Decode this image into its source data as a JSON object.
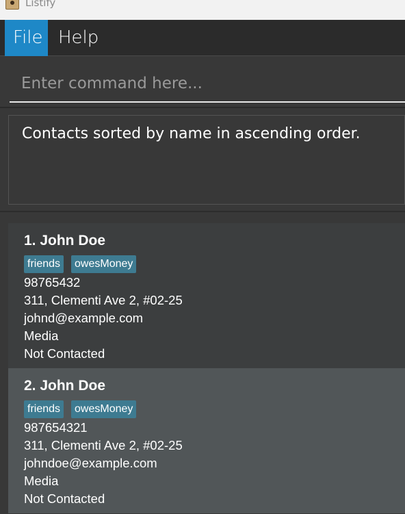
{
  "window": {
    "title": "Listify"
  },
  "menu": {
    "file_label": "File",
    "help_label": "Help"
  },
  "command": {
    "placeholder": "Enter command here..."
  },
  "result": {
    "message": "Contacts sorted by name in ascending order."
  },
  "contacts": [
    {
      "name": "1. John Doe",
      "tags": [
        "friends",
        "owesMoney"
      ],
      "phone": "98765432",
      "address": "311, Clementi Ave 2, #02-25",
      "email": "johnd@example.com",
      "media": "Media",
      "status": "Not Contacted"
    },
    {
      "name": "2. John Doe",
      "tags": [
        "friends",
        "owesMoney"
      ],
      "phone": "987654321",
      "address": "311, Clementi Ave 2, #02-25",
      "email": "johndoe@example.com",
      "media": "Media",
      "status": "Not Contacted"
    }
  ],
  "colors": {
    "accent": "#1e88c7",
    "tag": "#3e7b91",
    "card_default": "#3c3e3f",
    "card_selected": "#515658"
  }
}
